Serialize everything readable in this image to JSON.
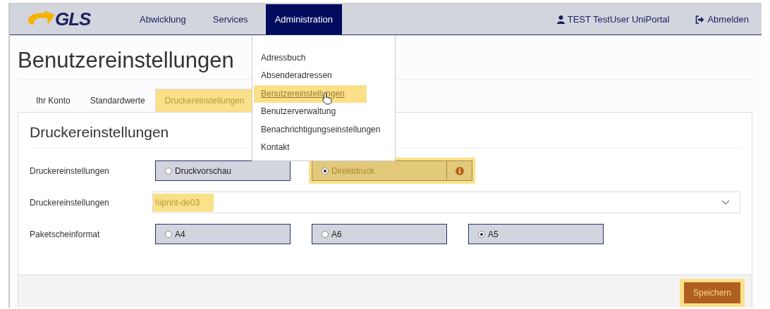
{
  "header": {
    "logo": "GLS",
    "nav": [
      {
        "label": "Abwicklung",
        "selected": false
      },
      {
        "label": "Services",
        "selected": false
      },
      {
        "label": "Administration",
        "selected": true
      }
    ],
    "user": "TEST TestUser UniPortal",
    "logout": "Abmelden"
  },
  "page_title": "Benutzereinstellungen",
  "tabs": [
    {
      "label": "Ihr Konto",
      "selected": false,
      "highlighted": false
    },
    {
      "label": "Standardwerte",
      "selected": false,
      "highlighted": false
    },
    {
      "label": "Druckereinstellungen",
      "selected": true,
      "highlighted": true
    }
  ],
  "menu": {
    "items": [
      {
        "label": "Adressbuch",
        "selected": false,
        "highlighted": false
      },
      {
        "label": "Absenderadressen",
        "selected": false,
        "highlighted": false
      },
      {
        "label": "Benutzereinstellungen",
        "selected": true,
        "highlighted": true
      },
      {
        "label": "Benutzerverwaltung",
        "selected": false,
        "highlighted": false
      },
      {
        "label": "Benachrichtigungseinstellungen",
        "selected": false,
        "highlighted": false
      },
      {
        "label": "Kontakt",
        "selected": false,
        "highlighted": false
      }
    ]
  },
  "panel": {
    "title": "Druckereinstellungen",
    "rows": [
      {
        "kind": "radio",
        "label": "Druckereinstellungen",
        "options": [
          {
            "label": "Druckvorschau",
            "selected": false,
            "highlighted": false,
            "info": false
          },
          {
            "label": "Direktdruck",
            "selected": true,
            "highlighted": true,
            "info": true
          }
        ]
      },
      {
        "kind": "select",
        "label": "Druckereinstellungen",
        "value": "\\\\iprint-de03",
        "highlighted": true
      },
      {
        "kind": "radio",
        "label": "Paketscheinformat",
        "options": [
          {
            "label": "A4",
            "selected": false,
            "highlighted": false,
            "info": false
          },
          {
            "label": "A6",
            "selected": false,
            "highlighted": false,
            "info": false
          },
          {
            "label": "A5",
            "selected": true,
            "highlighted": false,
            "info": false
          }
        ]
      }
    ],
    "save": {
      "label": "Speichern",
      "highlighted": true
    }
  }
}
